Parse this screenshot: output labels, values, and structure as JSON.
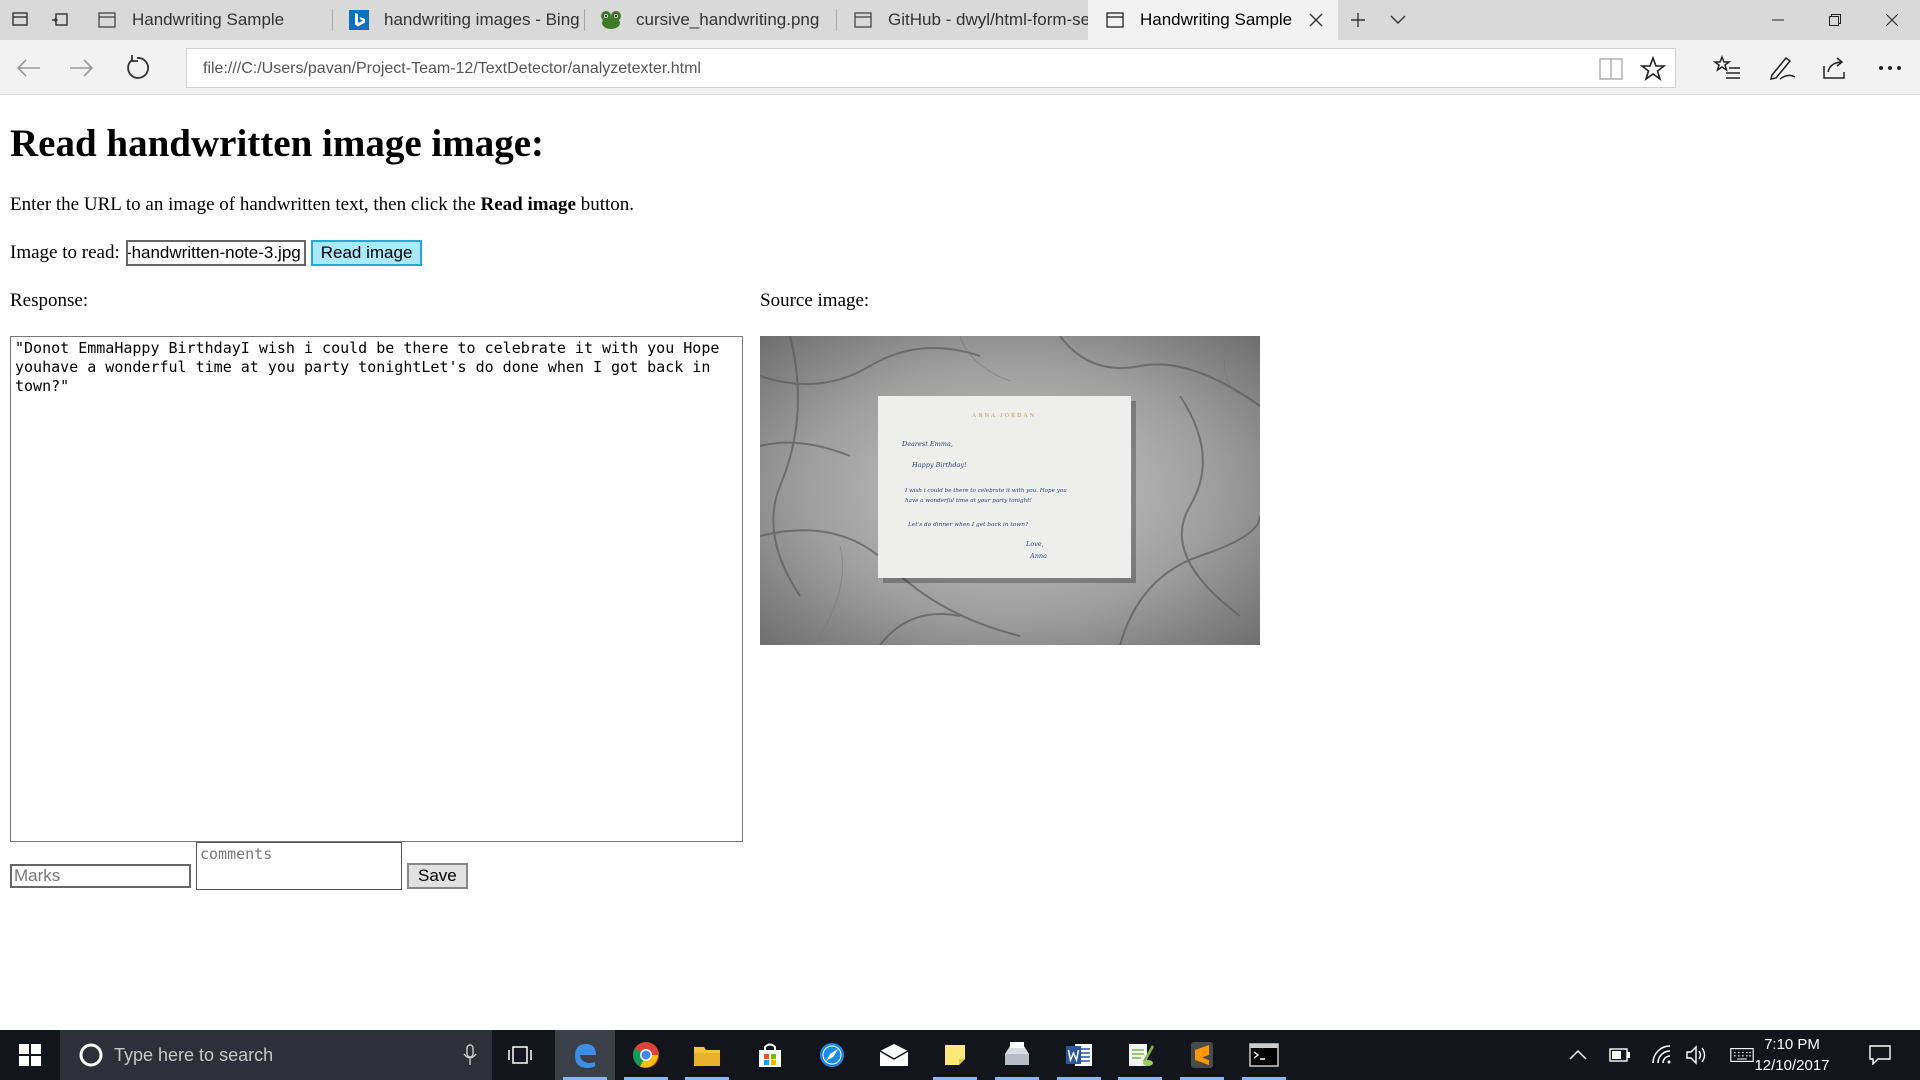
{
  "browser": {
    "tabs": [
      {
        "title": "Handwriting Sample",
        "icon": "page-icon",
        "active": false
      },
      {
        "title": "handwriting images - Bing i",
        "icon": "bing-icon",
        "active": false
      },
      {
        "title": "cursive_handwriting.png",
        "icon": "frog-icon",
        "active": false
      },
      {
        "title": "GitHub - dwyl/html-form-se",
        "icon": "page-icon",
        "active": false
      },
      {
        "title": "Handwriting Sample",
        "icon": "page-icon",
        "active": true
      }
    ],
    "address": "file:///C:/Users/pavan/Project-Team-12/TextDetector/analyzetexter.html"
  },
  "page": {
    "heading": "Read handwritten image image:",
    "intro_before": "Enter the URL to an image of handwritten text, then click the ",
    "intro_bold": "Read image",
    "intro_after": " button.",
    "image_label": "Image to read:",
    "image_url_value": "-handwritten-note-3.jpg",
    "read_button": "Read image",
    "response_label": "Response:",
    "source_label": "Source image:",
    "response_text": "\"Donot EmmaHappy BirthdayI wish i could be there to celebrate it with you Hope youhave a wonderful time at you party tonightLet's do done when I got back in town?\"",
    "marks_placeholder": "Marks",
    "comments_placeholder": "comments",
    "save_button": "Save",
    "note_card": {
      "letterhead": "ANNA JORDAN",
      "lines": [
        "Dearest Emma,",
        "Happy Birthday!",
        "I wish i could be there to celebrate it with you. Hope you",
        "have a wonderful time at your party tonight!",
        "Let's do dinner when I get back in town?",
        "Love,",
        "Anna"
      ]
    }
  },
  "taskbar": {
    "search_placeholder": "Type here to search",
    "time": "7:10 PM",
    "date": "12/10/2017"
  },
  "colors": {
    "read_button_bg": "#a9e9fb",
    "read_button_border": "#25a8d6",
    "taskbar_bg": "#12151c",
    "tabstrip_bg": "#d9d9d9"
  }
}
